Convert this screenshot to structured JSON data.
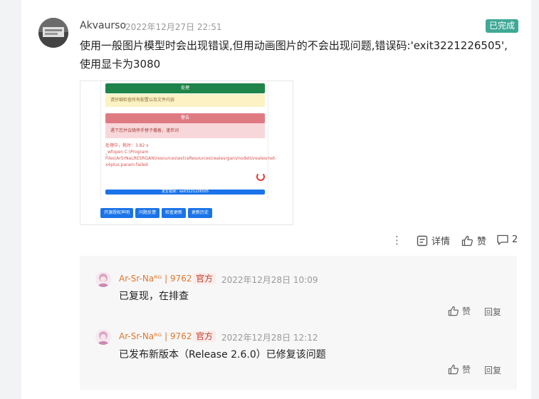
{
  "post": {
    "author": "Akvaurso",
    "time": "2022年12月27日 22:51",
    "status": "已完成",
    "status_color": "#3fa896",
    "content": "使用一般图片模型时会出现错误,但用动画图片的不会出现问题,错误码:'exit3221226505',使用显卡为3080"
  },
  "attachment": {
    "title_green": "处理",
    "notice_yellow": "请仔细检查所有配置以及文件内容",
    "title_red": "警告",
    "notice_red": "遇下您并会随停手替子撒着，谨恭词",
    "error_line": "处理中，耗时：3.82 s",
    "error_detail": "_wfopen C:\\Program Files\\Ar5rNaLRESRGAN\\resources\\extraResources\\realesrgan\\models\\realesrnet-x4plus.param failed",
    "progress_text": "发生错误：exit3221226505",
    "buttons": [
      "开源授权声明",
      "问题反馈",
      "检查更新",
      "更新历史"
    ]
  },
  "post_actions": {
    "more": "⋮",
    "detail": "详情",
    "like": "赞",
    "comment_count": "2"
  },
  "replies": [
    {
      "name": "Ar-Sr-Naᴿᴳ | 9762",
      "tag": "官方",
      "time": "2022年12月28日 10:09",
      "text": "已复现，在排查",
      "like": "赞",
      "reply": "回复"
    },
    {
      "name": "Ar-Sr-Naᴿᴳ | 9762",
      "tag": "官方",
      "time": "2022年12月28日 12:12",
      "text": "已发布新版本（Release 2.6.0）已修复该问题",
      "like": "赞",
      "reply": "回复"
    }
  ]
}
